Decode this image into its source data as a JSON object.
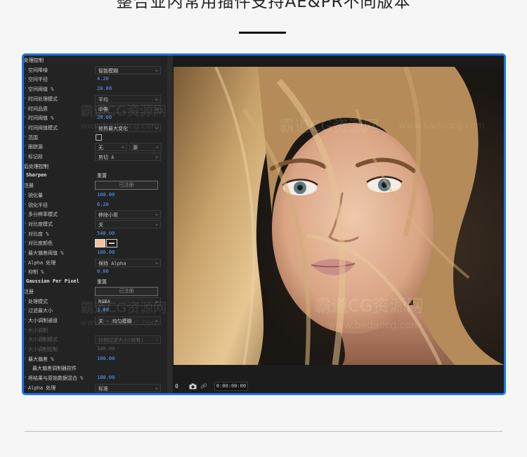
{
  "headline": "整合业内常用插件支持AE&PR不同版本",
  "colors": {
    "frame_border": "#1b74e8",
    "value_text": "#5aa3ff",
    "color_swatch": "#f2c3a6"
  },
  "effect_controls": {
    "section_title": "处理控制",
    "spatial_denoise": "空间降噪",
    "spatial_denoise_value": "智能模糊",
    "spatial_radius": "空间半径",
    "spatial_radius_value": "4.20",
    "spatial_threshold": "空间阈值 %",
    "spatial_threshold_value": "20.00",
    "temporal_mode": "时间处理模式",
    "temporal_mode_value": "平均",
    "temporal_quality": "时间品质",
    "temporal_quality_value": "中等",
    "temporal_threshold": "时间阈值 %",
    "temporal_threshold_value": "20.00",
    "temporal_threshold_mode": "时间阈值模式",
    "temporal_threshold_mode_value": "修剪最大变化",
    "range": "范围",
    "trace_source": "跟踪源",
    "trace_source_value": "无",
    "trace_source_value2": "源",
    "marker": "标记段",
    "marker_value": "剪切 A",
    "post_section": "后处理控制",
    "sharpen_title": "Sharpen",
    "reset": "重置",
    "register": "注册",
    "registered_button": "已注册",
    "sharpen_amount": "锐化量",
    "sharpen_amount_value": "100.00",
    "sharpen_radius": "锐化半径",
    "sharpen_radius_value": "6.20",
    "multi_res_mode": "多分辨率模式",
    "multi_res_mode_value": "移除小斑",
    "contrast_mode": "对比度模式",
    "contrast_mode_value": "关",
    "contrast_pct": "对比度 %",
    "contrast_pct_value": "540.00",
    "contrast_color": "对比度颜色",
    "max_dev": "最大偏差阈值 %",
    "max_dev_value": "100.00",
    "alpha_handle": "Alpha 处理",
    "alpha_handle_value": "保持 Alpha",
    "suppress": "抑制 %",
    "suppress_value": "0.00",
    "gaussian_title": "Gaussian Per Pixel",
    "reset2": "重置",
    "register2": "注册",
    "registered_button2": "已注册",
    "process_mode": "处理模式",
    "process_mode_value": "RGBA",
    "filter_max": "过滤最大小",
    "filter_max_value": "1.80",
    "size_channel": "大小调制通道",
    "size_channel_value": "关 - 均匀模糊",
    "size_mod_layer": "大小调制",
    "size_mod_mode": "大小调制模式",
    "size_mod_mode_value": "比例过滤大小(如有)",
    "size_mod_control": "大小调制控制",
    "size_mod_control_value": "100.00",
    "max_deviation": "最大偏差 %",
    "max_deviation_value": "100.00",
    "max_dev_controller": "最大偏差调制器控件",
    "blend_orig": "将结果与原始数据混合 %",
    "blend_orig_value": "100.00",
    "alpha_handle2": "Alpha 处理",
    "alpha_handle2_value": "标准"
  },
  "watermark": {
    "brand": "霸道CG资源网",
    "url": "www.badaocg.com"
  },
  "monitor": {
    "frame_value": "0",
    "timecode": "0:00:00:00",
    "icons": [
      "camera-icon",
      "link-icon"
    ]
  }
}
